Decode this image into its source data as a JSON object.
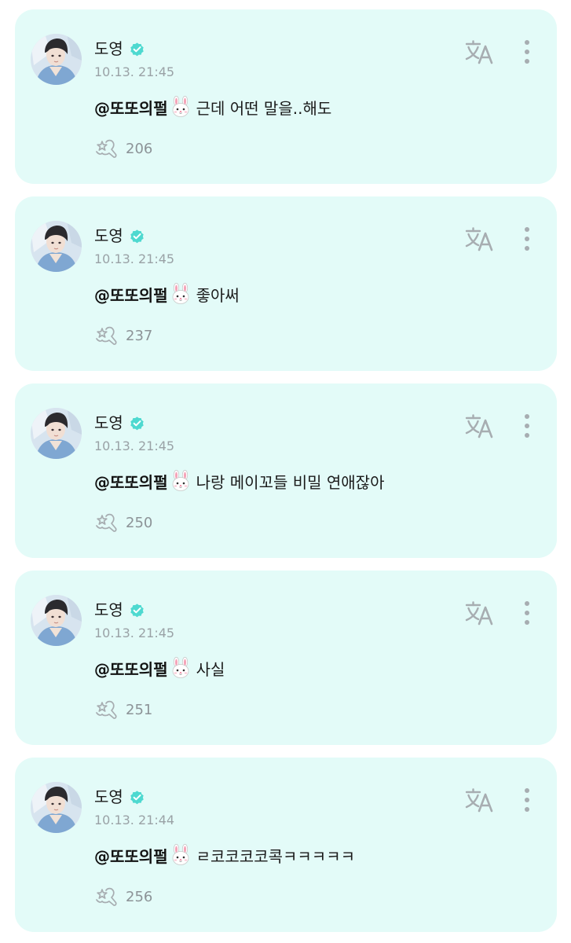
{
  "posts": [
    {
      "author": "도영",
      "timestamp": "10.13. 21:45",
      "mention": "@또또의펄",
      "text": "근데 어떤 말을..해도",
      "reaction_count": "206"
    },
    {
      "author": "도영",
      "timestamp": "10.13. 21:45",
      "mention": "@또또의펄",
      "text": "좋아써",
      "reaction_count": "237"
    },
    {
      "author": "도영",
      "timestamp": "10.13. 21:45",
      "mention": "@또또의펄",
      "text": "나랑 메이꼬들 비밀 연애잖아",
      "reaction_count": "250"
    },
    {
      "author": "도영",
      "timestamp": "10.13. 21:45",
      "mention": "@또또의펄",
      "text": "사실",
      "reaction_count": "251"
    },
    {
      "author": "도영",
      "timestamp": "10.13. 21:44",
      "mention": "@또또의펄",
      "text": "ㄹ코코코코콕ㅋㅋㅋㅋㅋ",
      "reaction_count": "256"
    }
  ],
  "icons": {
    "verified": "verified-badge-icon",
    "bunny": "rabbit-face-emoji",
    "reaction": "cheer-heart-hand-icon",
    "translate": "translate-icon",
    "more": "more-vertical-icon"
  },
  "colors": {
    "card_background": "#e3fbf8",
    "accent": "#4ed9d0",
    "icon_gray": "#a7adb1",
    "muted_text": "#9aa2a6"
  }
}
